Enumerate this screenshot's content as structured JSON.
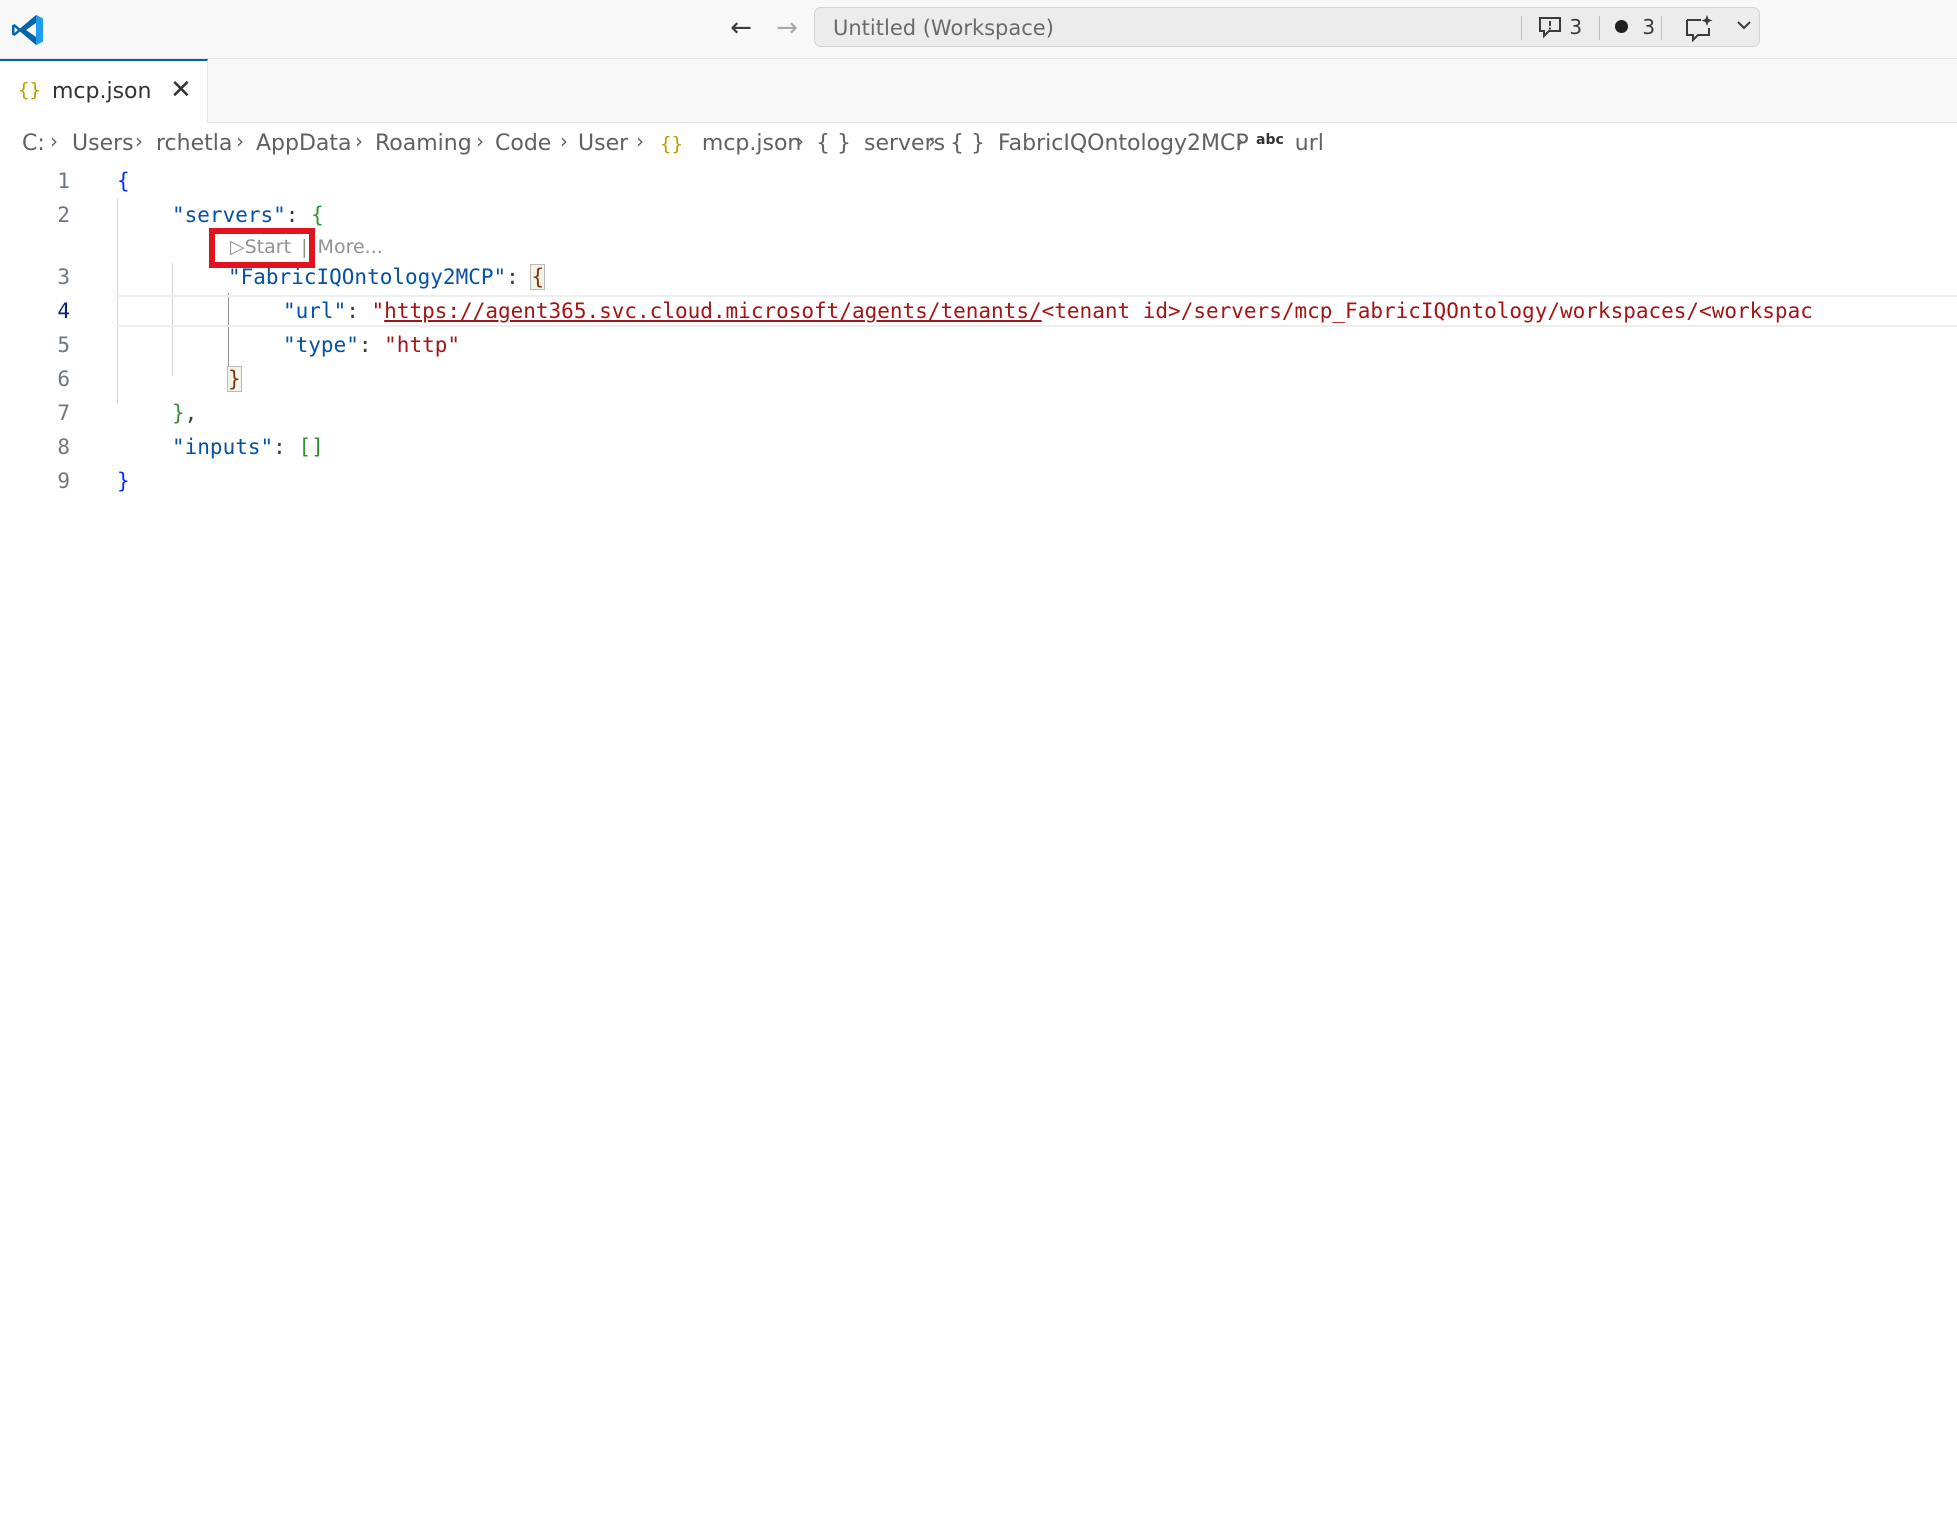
{
  "titlebar": {
    "workspace_title": "Untitled (Workspace)",
    "comments_count": "3",
    "problems_count": "3",
    "icons": [
      "vscode-logo-icon",
      "arrow-left-icon",
      "arrow-right-icon",
      "comment-icon",
      "dot-icon",
      "chat-sparkle-icon",
      "chevron-down-icon"
    ]
  },
  "tab": {
    "label": "mcp.json",
    "icon": "{}"
  },
  "breadcrumb": {
    "items": [
      "C:",
      "Users",
      "rchetla",
      "AppData",
      "Roaming",
      "Code",
      "User",
      "mcp.json",
      "servers",
      "FabricIQOntology2MCP",
      "url"
    ],
    "json_icon": "{}",
    "object_icon": "{ }",
    "string_icon": "abc"
  },
  "codelens": {
    "start_label": "Start",
    "separator": "|",
    "more_label": "More..."
  },
  "editor": {
    "line_numbers": [
      "1",
      "2",
      "3",
      "4",
      "5",
      "6",
      "7",
      "8",
      "9"
    ],
    "active_line": "4",
    "lines": {
      "l1_brace": "{",
      "l2_key": "\"servers\"",
      "l2_colon": ": ",
      "l2_brace": "{",
      "l3_key": "\"FabricIQOntology2MCP\"",
      "l3_colon": ": ",
      "l3_brace": "{",
      "l4_key": "\"url\"",
      "l4_colon": ": ",
      "l4_quote": "\"",
      "l4_url_a": "https://agent365.svc.cloud.microsoft/agents/tenants/",
      "l4_url_b": "<tenant id>/servers/mcp_FabricIQOntology/workspaces/<workspac",
      "l5_key": "\"type\"",
      "l5_colon": ": ",
      "l5_value": "\"http\"",
      "l6_brace": "}",
      "l7_brace": "}",
      "l7_comma": ",",
      "l8_key": "\"inputs\"",
      "l8_colon": ": ",
      "l8_array": "[]",
      "l9_brace": "}"
    }
  },
  "colors": {
    "accent": "#005fb8",
    "json_key": "#0451a5",
    "json_string": "#a31515",
    "highlight_box": "#e0141e"
  }
}
